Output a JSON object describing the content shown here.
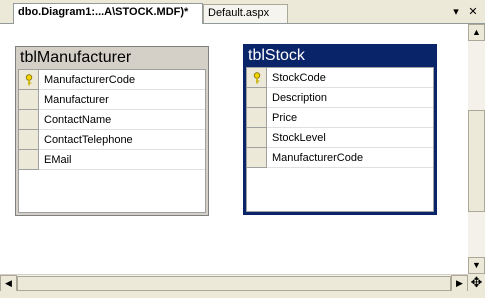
{
  "tabs": [
    {
      "label": "dbo.Diagram1:...A\\STOCK.MDF)*",
      "active": true
    },
    {
      "label": "Default.aspx",
      "active": false
    }
  ],
  "strip_controls": {
    "dropdown": "▾",
    "close": "✕"
  },
  "tables": {
    "manufacturer": {
      "title": "tblManufacturer",
      "columns": [
        {
          "name": "ManufacturerCode",
          "primary_key": true
        },
        {
          "name": "Manufacturer",
          "primary_key": false
        },
        {
          "name": "ContactName",
          "primary_key": false
        },
        {
          "name": "ContactTelephone",
          "primary_key": false
        },
        {
          "name": "EMail",
          "primary_key": false
        }
      ]
    },
    "stock": {
      "title": "tblStock",
      "selected": true,
      "columns": [
        {
          "name": "StockCode",
          "primary_key": true
        },
        {
          "name": "Description",
          "primary_key": false
        },
        {
          "name": "Price",
          "primary_key": false
        },
        {
          "name": "StockLevel",
          "primary_key": false
        },
        {
          "name": "ManufacturerCode",
          "primary_key": false
        }
      ]
    }
  },
  "scrollbar": {
    "up": "▲",
    "down": "▼",
    "left": "◀",
    "right": "▶",
    "vertical_position": 0.35,
    "horizontal_position": 0.0
  },
  "corner_icon": "✥",
  "colors": {
    "selected_title": "#0a246a",
    "unselected_title": "#d4d0c8",
    "chrome": "#ece9d8"
  }
}
